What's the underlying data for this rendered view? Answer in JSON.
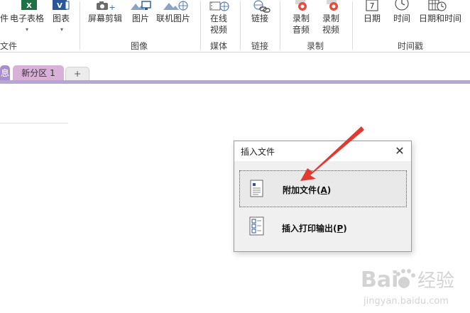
{
  "ribbon": {
    "buttons": {
      "file_partial": "件",
      "spreadsheet": "电子表格",
      "chart": "图表",
      "screen_clip": "屏幕剪辑",
      "picture": "图片",
      "online_picture": "联机图片",
      "online_video_line1": "在线",
      "online_video_line2": "视频",
      "link": "链接",
      "record_audio_line1": "录制",
      "record_audio_line2": "音频",
      "record_video_line1": "录制",
      "record_video_line2": "视频",
      "date": "日期",
      "time": "时间",
      "date_time": "日期和时间"
    },
    "groups": {
      "files_partial": "文件",
      "images": "图像",
      "media": "媒体",
      "links": "链接",
      "recording": "录制",
      "timestamp": "时间戳"
    },
    "icons": {
      "calendar_day": "7"
    }
  },
  "section_tabs": {
    "partial_tab": "息",
    "new_section": "新分区 1",
    "add_tab": "+"
  },
  "dialog": {
    "title": "插入文件",
    "close": "✕",
    "option1": {
      "label": "附加文件(",
      "key": "A",
      "suffix": ")"
    },
    "option2": {
      "label": "插入打印输出(",
      "key": "P",
      "suffix": ")"
    }
  },
  "watermark": {
    "brand_part1": "Bai",
    "brand_part2": "经验",
    "url": "jingyan.baidu.com"
  },
  "colors": {
    "section_tab": "#d8b0d8",
    "section_bar": "#b4a7d6",
    "excel_green": "#1e7145",
    "visio_blue": "#2b579a",
    "annotation_arrow": "#e03a32"
  }
}
